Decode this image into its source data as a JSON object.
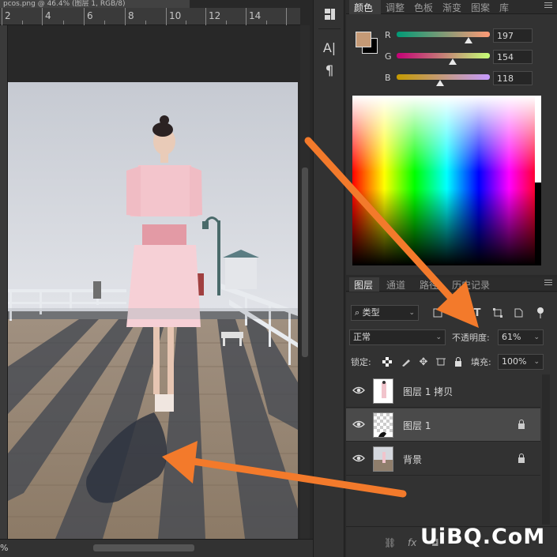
{
  "document": {
    "tab_title": "pcos.png @ 46.4% (图层 1, RGB/8)",
    "ruler_labels": [
      "2",
      "4",
      "6",
      "8",
      "10",
      "12",
      "14"
    ],
    "zoom": "%"
  },
  "mid_toolbar": {
    "char_icon": "A|",
    "para_icon": "¶"
  },
  "color_panel": {
    "tabs": [
      "颜色",
      "调整",
      "色板",
      "渐变",
      "图案",
      "库"
    ],
    "active_tab": "颜色",
    "foreground_color": "#c59a76",
    "background_color": "#000000",
    "channels": [
      {
        "label": "R",
        "value": "197",
        "fraction": 0.773
      },
      {
        "label": "G",
        "value": "154",
        "fraction": 0.604
      },
      {
        "label": "B",
        "value": "118",
        "fraction": 0.463
      }
    ]
  },
  "layers_panel": {
    "tabs": [
      "图层",
      "通道",
      "路径",
      "历史记录"
    ],
    "active_tab": "图层",
    "filter_kind": "类型",
    "blend_mode": "正常",
    "opacity_label": "不透明度:",
    "opacity_value": "61%",
    "lock_label": "锁定:",
    "fill_label": "填充:",
    "fill_value": "100%",
    "layers": [
      {
        "name": "图层 1 拷贝",
        "visible": true,
        "selected": false,
        "locked": false
      },
      {
        "name": "图层 1",
        "visible": true,
        "selected": true,
        "locked": true
      },
      {
        "name": "背景",
        "visible": true,
        "selected": false,
        "locked": true
      }
    ],
    "footer_fx": "fx"
  },
  "watermark": "UiBQ.CoM",
  "annotation_color": "#f37a2b"
}
